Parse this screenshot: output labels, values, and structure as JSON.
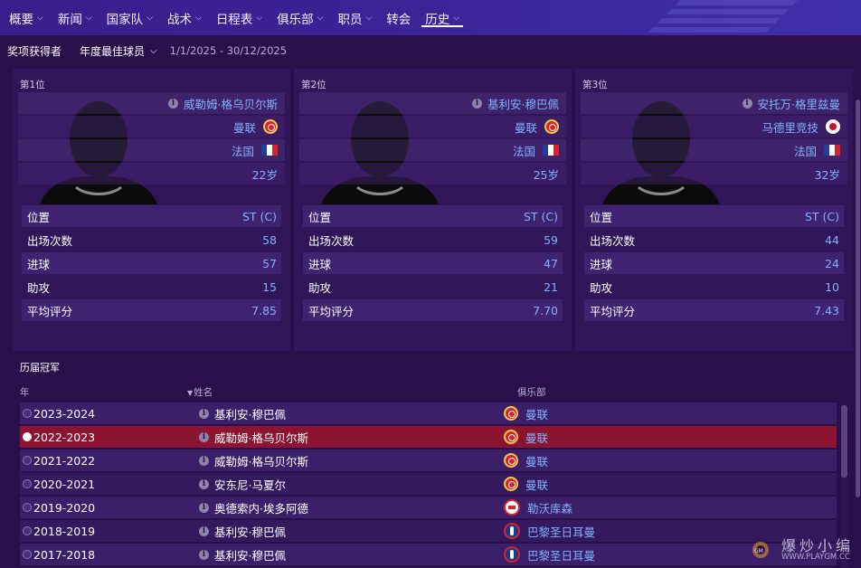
{
  "nav": {
    "items": [
      {
        "label": "概要",
        "chevron": true,
        "active": false
      },
      {
        "label": "新闻",
        "chevron": true,
        "active": false
      },
      {
        "label": "国家队",
        "chevron": true,
        "active": false
      },
      {
        "label": "战术",
        "chevron": true,
        "active": false
      },
      {
        "label": "日程表",
        "chevron": true,
        "active": false
      },
      {
        "label": "俱乐部",
        "chevron": true,
        "active": false
      },
      {
        "label": "职员",
        "chevron": true,
        "active": false
      },
      {
        "label": "转会",
        "chevron": false,
        "active": false
      },
      {
        "label": "历史",
        "chevron": true,
        "active": true
      }
    ]
  },
  "subbar": {
    "label": "奖项获得者",
    "award_select": "年度最佳球员",
    "date_range": "1/1/2025 - 30/12/2025"
  },
  "cards": [
    {
      "place": "第1位",
      "name": "威勒姆·格乌贝尔斯",
      "club": "曼联",
      "club_badge": "manutd-badge",
      "nation": "法国",
      "age": "22岁",
      "stats": [
        {
          "k": "位置",
          "v": "ST (C)"
        },
        {
          "k": "出场次数",
          "v": "58"
        },
        {
          "k": "进球",
          "v": "57"
        },
        {
          "k": "助攻",
          "v": "15"
        },
        {
          "k": "平均评分",
          "v": "7.85"
        }
      ]
    },
    {
      "place": "第2位",
      "name": "基利安·穆巴佩",
      "club": "曼联",
      "club_badge": "manutd-badge",
      "nation": "法国",
      "age": "25岁",
      "stats": [
        {
          "k": "位置",
          "v": "ST (C)"
        },
        {
          "k": "出场次数",
          "v": "59"
        },
        {
          "k": "进球",
          "v": "47"
        },
        {
          "k": "助攻",
          "v": "21"
        },
        {
          "k": "平均评分",
          "v": "7.70"
        }
      ]
    },
    {
      "place": "第3位",
      "name": "安托万·格里兹曼",
      "club": "马德里竞技",
      "club_badge": "atletico-badge",
      "nation": "法国",
      "age": "32岁",
      "stats": [
        {
          "k": "位置",
          "v": "ST (C)"
        },
        {
          "k": "出场次数",
          "v": "44"
        },
        {
          "k": "进球",
          "v": "24"
        },
        {
          "k": "助攻",
          "v": "10"
        },
        {
          "k": "平均评分",
          "v": "7.43"
        }
      ]
    }
  ],
  "history": {
    "title": "历届冠军",
    "headers": {
      "year": "年",
      "name": "姓名",
      "club": "俱乐部"
    },
    "rows": [
      {
        "year": "2023-2024",
        "name": "基利安·穆巴佩",
        "club": "曼联",
        "badge": "manutd",
        "selected": false
      },
      {
        "year": "2022-2023",
        "name": "威勒姆·格乌贝尔斯",
        "club": "曼联",
        "badge": "manutd",
        "selected": true
      },
      {
        "year": "2021-2022",
        "name": "威勒姆·格乌贝尔斯",
        "club": "曼联",
        "badge": "manutd",
        "selected": false
      },
      {
        "year": "2020-2021",
        "name": "安东尼·马夏尔",
        "club": "曼联",
        "badge": "manutd",
        "selected": false
      },
      {
        "year": "2019-2020",
        "name": "奥德索内·埃多阿德",
        "club": "勒沃库森",
        "badge": "leverkusen",
        "selected": false
      },
      {
        "year": "2018-2019",
        "name": "基利安·穆巴佩",
        "club": "巴黎圣日耳曼",
        "badge": "psg",
        "selected": false
      },
      {
        "year": "2017-2018",
        "name": "基利安·穆巴佩",
        "club": "巴黎圣日耳曼",
        "badge": "psg",
        "selected": false
      }
    ]
  },
  "watermark": {
    "text": "爆炒小编",
    "url": "WWW.PLAYGM.CC"
  },
  "colors": {
    "background": "#2a0f4a",
    "nav": "#3a1d8a",
    "accent_value": "#7fb4ff",
    "selected_row": "#8d1430"
  }
}
